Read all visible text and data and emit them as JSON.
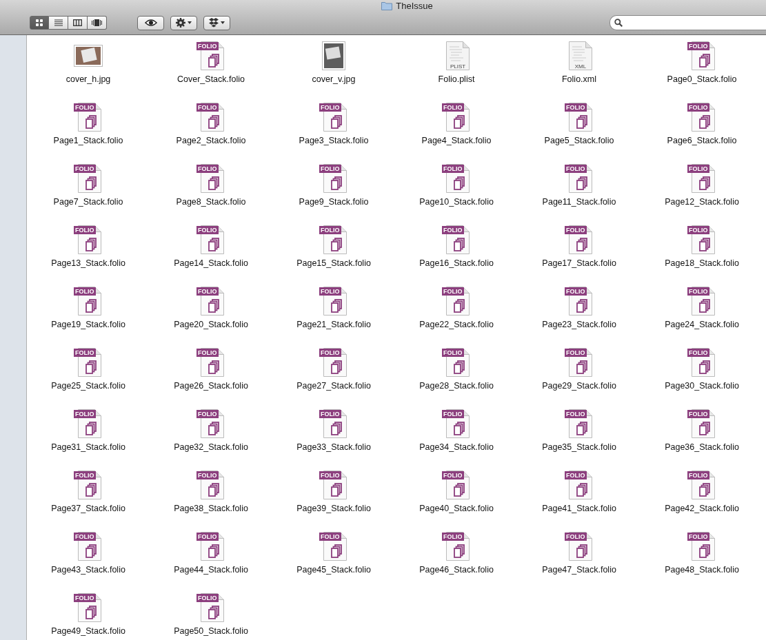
{
  "window": {
    "title": "TheIssue"
  },
  "view_buttons": [
    {
      "selected": true
    },
    {
      "selected": false
    },
    {
      "selected": false
    },
    {
      "selected": false
    }
  ],
  "files": [
    {
      "name": "cover_h.jpg",
      "kind": "image"
    },
    {
      "name": "Cover_Stack.folio",
      "kind": "folio",
      "badge": "FOLIO"
    },
    {
      "name": "cover_v.jpg",
      "kind": "image_v"
    },
    {
      "name": "Folio.plist",
      "kind": "doc",
      "badge": "PLIST"
    },
    {
      "name": "Folio.xml",
      "kind": "doc",
      "badge": "XML"
    },
    {
      "name": "Page0_Stack.folio",
      "kind": "folio",
      "badge": "FOLIO"
    },
    {
      "name": "Page1_Stack.folio",
      "kind": "folio",
      "badge": "FOLIO"
    },
    {
      "name": "Page2_Stack.folio",
      "kind": "folio",
      "badge": "FOLIO"
    },
    {
      "name": "Page3_Stack.folio",
      "kind": "folio",
      "badge": "FOLIO"
    },
    {
      "name": "Page4_Stack.folio",
      "kind": "folio",
      "badge": "FOLIO"
    },
    {
      "name": "Page5_Stack.folio",
      "kind": "folio",
      "badge": "FOLIO"
    },
    {
      "name": "Page6_Stack.folio",
      "kind": "folio",
      "badge": "FOLIO"
    },
    {
      "name": "Page7_Stack.folio",
      "kind": "folio",
      "badge": "FOLIO"
    },
    {
      "name": "Page8_Stack.folio",
      "kind": "folio",
      "badge": "FOLIO"
    },
    {
      "name": "Page9_Stack.folio",
      "kind": "folio",
      "badge": "FOLIO"
    },
    {
      "name": "Page10_Stack.folio",
      "kind": "folio",
      "badge": "FOLIO"
    },
    {
      "name": "Page11_Stack.folio",
      "kind": "folio",
      "badge": "FOLIO"
    },
    {
      "name": "Page12_Stack.folio",
      "kind": "folio",
      "badge": "FOLIO"
    },
    {
      "name": "Page13_Stack.folio",
      "kind": "folio",
      "badge": "FOLIO"
    },
    {
      "name": "Page14_Stack.folio",
      "kind": "folio",
      "badge": "FOLIO"
    },
    {
      "name": "Page15_Stack.folio",
      "kind": "folio",
      "badge": "FOLIO"
    },
    {
      "name": "Page16_Stack.folio",
      "kind": "folio",
      "badge": "FOLIO"
    },
    {
      "name": "Page17_Stack.folio",
      "kind": "folio",
      "badge": "FOLIO"
    },
    {
      "name": "Page18_Stack.folio",
      "kind": "folio",
      "badge": "FOLIO"
    },
    {
      "name": "Page19_Stack.folio",
      "kind": "folio",
      "badge": "FOLIO"
    },
    {
      "name": "Page20_Stack.folio",
      "kind": "folio",
      "badge": "FOLIO"
    },
    {
      "name": "Page21_Stack.folio",
      "kind": "folio",
      "badge": "FOLIO"
    },
    {
      "name": "Page22_Stack.folio",
      "kind": "folio",
      "badge": "FOLIO"
    },
    {
      "name": "Page23_Stack.folio",
      "kind": "folio",
      "badge": "FOLIO"
    },
    {
      "name": "Page24_Stack.folio",
      "kind": "folio",
      "badge": "FOLIO"
    },
    {
      "name": "Page25_Stack.folio",
      "kind": "folio",
      "badge": "FOLIO"
    },
    {
      "name": "Page26_Stack.folio",
      "kind": "folio",
      "badge": "FOLIO"
    },
    {
      "name": "Page27_Stack.folio",
      "kind": "folio",
      "badge": "FOLIO"
    },
    {
      "name": "Page28_Stack.folio",
      "kind": "folio",
      "badge": "FOLIO"
    },
    {
      "name": "Page29_Stack.folio",
      "kind": "folio",
      "badge": "FOLIO"
    },
    {
      "name": "Page30_Stack.folio",
      "kind": "folio",
      "badge": "FOLIO"
    },
    {
      "name": "Page31_Stack.folio",
      "kind": "folio",
      "badge": "FOLIO"
    },
    {
      "name": "Page32_Stack.folio",
      "kind": "folio",
      "badge": "FOLIO"
    },
    {
      "name": "Page33_Stack.folio",
      "kind": "folio",
      "badge": "FOLIO"
    },
    {
      "name": "Page34_Stack.folio",
      "kind": "folio",
      "badge": "FOLIO"
    },
    {
      "name": "Page35_Stack.folio",
      "kind": "folio",
      "badge": "FOLIO"
    },
    {
      "name": "Page36_Stack.folio",
      "kind": "folio",
      "badge": "FOLIO"
    },
    {
      "name": "Page37_Stack.folio",
      "kind": "folio",
      "badge": "FOLIO"
    },
    {
      "name": "Page38_Stack.folio",
      "kind": "folio",
      "badge": "FOLIO"
    },
    {
      "name": "Page39_Stack.folio",
      "kind": "folio",
      "badge": "FOLIO"
    },
    {
      "name": "Page40_Stack.folio",
      "kind": "folio",
      "badge": "FOLIO"
    },
    {
      "name": "Page41_Stack.folio",
      "kind": "folio",
      "badge": "FOLIO"
    },
    {
      "name": "Page42_Stack.folio",
      "kind": "folio",
      "badge": "FOLIO"
    },
    {
      "name": "Page43_Stack.folio",
      "kind": "folio",
      "badge": "FOLIO"
    },
    {
      "name": "Page44_Stack.folio",
      "kind": "folio",
      "badge": "FOLIO"
    },
    {
      "name": "Page45_Stack.folio",
      "kind": "folio",
      "badge": "FOLIO"
    },
    {
      "name": "Page46_Stack.folio",
      "kind": "folio",
      "badge": "FOLIO"
    },
    {
      "name": "Page47_Stack.folio",
      "kind": "folio",
      "badge": "FOLIO"
    },
    {
      "name": "Page48_Stack.folio",
      "kind": "folio",
      "badge": "FOLIO"
    },
    {
      "name": "Page49_Stack.folio",
      "kind": "folio",
      "badge": "FOLIO"
    },
    {
      "name": "Page50_Stack.folio",
      "kind": "folio",
      "badge": "FOLIO"
    }
  ]
}
